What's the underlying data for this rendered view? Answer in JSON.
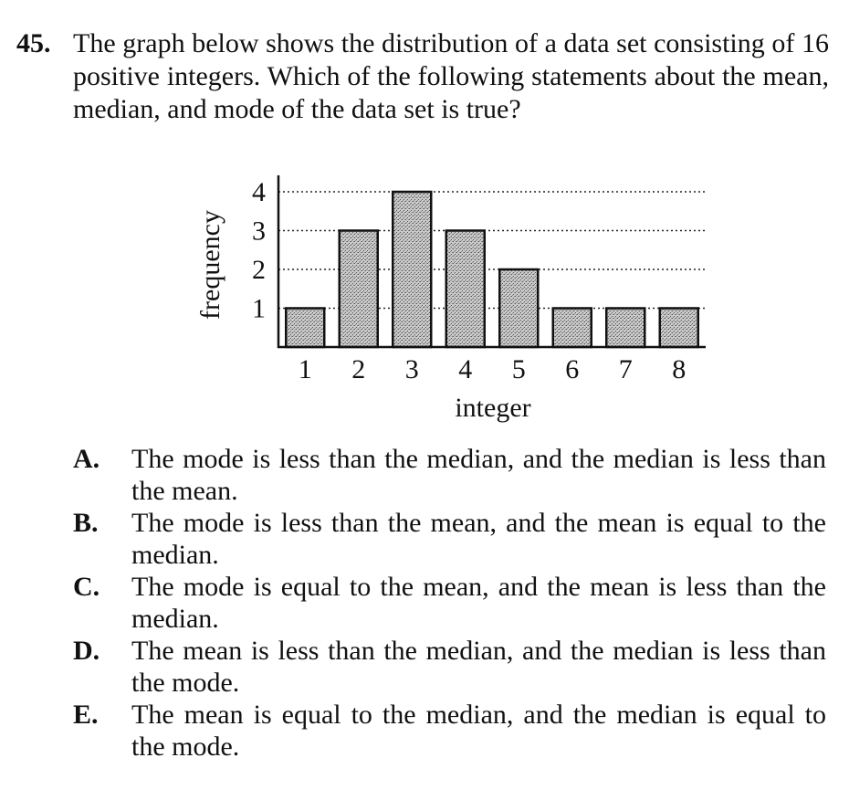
{
  "question": {
    "number": "45.",
    "text": "The graph below shows the distribution of a data set consisting of 16 positive integers. Which of the following statements about the mean, median, and mode of the data set is true?"
  },
  "chart_data": {
    "type": "bar",
    "categories": [
      "1",
      "2",
      "3",
      "4",
      "5",
      "6",
      "7",
      "8"
    ],
    "values": [
      1,
      3,
      4,
      3,
      2,
      1,
      1,
      1
    ],
    "xlabel": "integer",
    "ylabel": "frequency",
    "yticks": [
      "1",
      "2",
      "3",
      "4"
    ],
    "ylim": [
      0,
      4
    ],
    "grid": "dotted horizontal",
    "bar_fill": "stippled gray"
  },
  "choices": [
    {
      "letter": "A.",
      "text": "The mode is less than the median, and the median is less than the mean."
    },
    {
      "letter": "B.",
      "text": "The mode is less than the mean, and the mean is equal to the median."
    },
    {
      "letter": "C.",
      "text": "The mode is equal to the mean, and the mean is less than the median."
    },
    {
      "letter": "D.",
      "text": "The mean is less than the median, and the median is less than the mode."
    },
    {
      "letter": "E.",
      "text": "The mean is equal to the median, and the median is equal to the mode."
    }
  ]
}
